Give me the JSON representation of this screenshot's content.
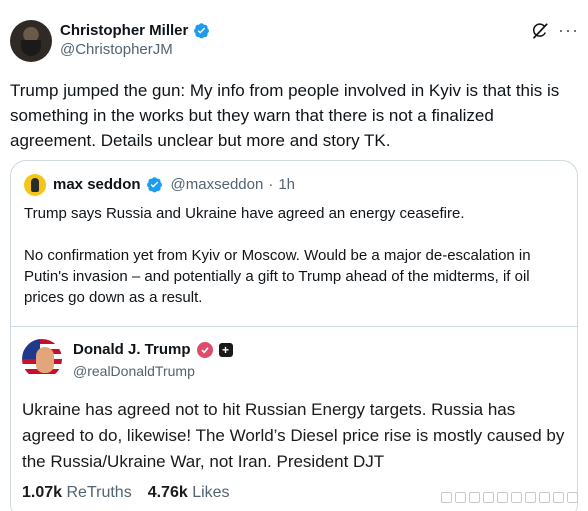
{
  "author": {
    "display_name": "Christopher Miller",
    "handle": "@ChristopherJM",
    "verified": true,
    "avatar_icon": "person-avatar-icon"
  },
  "tweet": {
    "text": "Trump jumped the gun: My info from people involved in Kyiv is that this is something in the works but they warn that there is not a finalized agreement. Details unclear but more and story TK."
  },
  "quote": {
    "display_name": "max seddon",
    "handle": "@maxseddon",
    "separator": "·",
    "time": "1h",
    "paragraphs": [
      "Trump says Russia and Ukraine have agreed an energy ceasefire.",
      "No confirmation yet from Kyiv or Moscow. Would be a major de-escalation in Putin's invasion – and potentially a gift to Trump ahead of the midterms, if oil prices go down as a result."
    ]
  },
  "embedded_post": {
    "display_name": "Donald J. Trump",
    "handle": "@realDonaldTrump",
    "text": "Ukraine has agreed not to hit Russian Energy targets. Russia has agreed to do, likewise! The World’s Diesel price rise is mostly caused by the Russia/Ukraine War, not Iran. President DJT",
    "retruths_count": "1.07k",
    "retruths_label": "ReTruths",
    "likes_count": "4.76k",
    "likes_label": "Likes"
  },
  "colors": {
    "verified_blue": "#1d9bf0",
    "secondary_text": "#536471",
    "border": "#cfd9de",
    "truth_badge": "#e04b6b"
  }
}
